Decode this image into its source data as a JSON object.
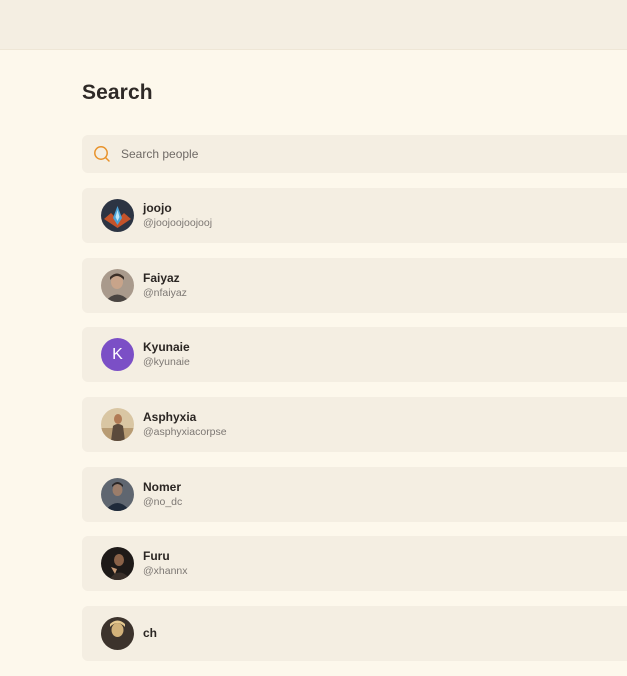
{
  "header": {
    "title": "Search"
  },
  "search": {
    "placeholder": "Search people",
    "value": ""
  },
  "people": [
    {
      "name": "joojo",
      "handle": "@joojoojoojooj",
      "avatar": "emblem-avatar"
    },
    {
      "name": "Faiyaz",
      "handle": "@nfaiyaz",
      "avatar": "photo-avatar"
    },
    {
      "name": "Kyunaie",
      "handle": "@kyunaie",
      "avatar": "letter-avatar",
      "initial": "K",
      "color": "#7b4fc6"
    },
    {
      "name": "Asphyxia",
      "handle": "@asphyxiacorpse",
      "avatar": "photo-avatar"
    },
    {
      "name": "Nomer",
      "handle": "@no_dc",
      "avatar": "photo-avatar"
    },
    {
      "name": "Furu",
      "handle": "@xhannx",
      "avatar": "photo-avatar"
    },
    {
      "name": "ch",
      "handle": "",
      "avatar": "photo-avatar"
    }
  ],
  "colors": {
    "background": "#fdf8ec",
    "panel": "#f4eee2",
    "accent": "#e8922a",
    "text": "#2b2623",
    "muted": "#7c7773"
  }
}
